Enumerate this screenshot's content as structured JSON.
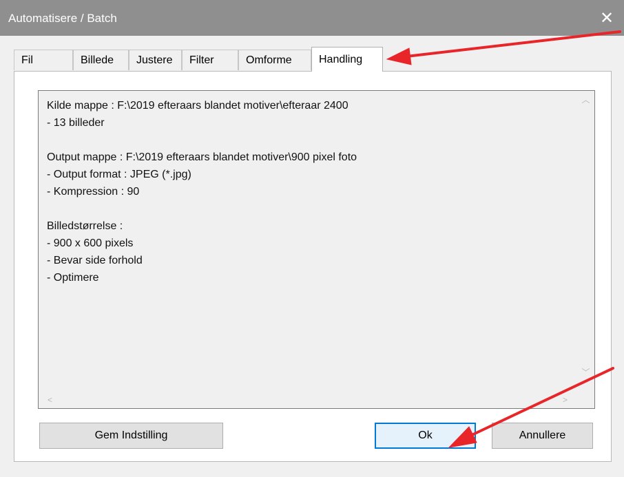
{
  "window": {
    "title": "Automatisere / Batch",
    "close_glyph": "✕"
  },
  "tabs": [
    {
      "label": "Fil",
      "active": false
    },
    {
      "label": "Billede",
      "active": false
    },
    {
      "label": "Justere",
      "active": false
    },
    {
      "label": "Filter",
      "active": false
    },
    {
      "label": "Omforme",
      "active": false
    },
    {
      "label": "Handling",
      "active": true
    }
  ],
  "summary": {
    "lines": [
      "Kilde mappe : F:\\2019 efteraars blandet motiver\\efteraar 2400",
      "- 13 billeder",
      "",
      "Output mappe : F:\\2019 efteraars blandet motiver\\900 pixel foto",
      "- Output format : JPEG (*.jpg)",
      "- Kompression : 90",
      "",
      "Billedstørrelse :",
      "- 900 x 600 pixels",
      "- Bevar side forhold",
      "- Optimere"
    ]
  },
  "buttons": {
    "save_settings": "Gem Indstilling",
    "ok": "Ok",
    "cancel": "Annullere"
  },
  "scroll_glyphs": {
    "up": "︿",
    "down": "﹀",
    "left": "<",
    "right": ">"
  },
  "colors": {
    "titlebar": "#8f8f8f",
    "annotation_arrow": "#e8262a",
    "default_button_border": "#0078d7"
  }
}
